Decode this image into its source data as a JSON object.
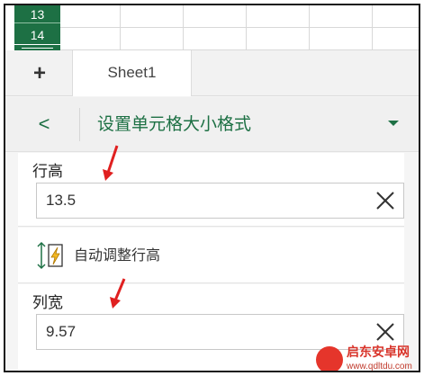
{
  "grid": {
    "row_numbers": [
      "13",
      "14"
    ]
  },
  "tabbar": {
    "add_label": "+",
    "sheet_tab": "Sheet1"
  },
  "panel": {
    "back_label": "<",
    "title": "设置单元格大小格式"
  },
  "row_height": {
    "label": "行高",
    "value": "13.5"
  },
  "auto_fit": {
    "label": "自动调整行高"
  },
  "col_width": {
    "label": "列宽",
    "value": "9.57"
  },
  "watermark": {
    "brand": "启东安卓网",
    "url": "www.qdltdu.com"
  },
  "colors": {
    "accent": "#1d7044",
    "annotation": "#e02020",
    "watermark": "#e5352b"
  },
  "icons": [
    "add-icon",
    "back-chevron-icon",
    "dropdown-caret-icon",
    "clear-x-icon",
    "autofit-row-height-icon",
    "annotation-arrow-icon",
    "watermark-logo-icon"
  ]
}
